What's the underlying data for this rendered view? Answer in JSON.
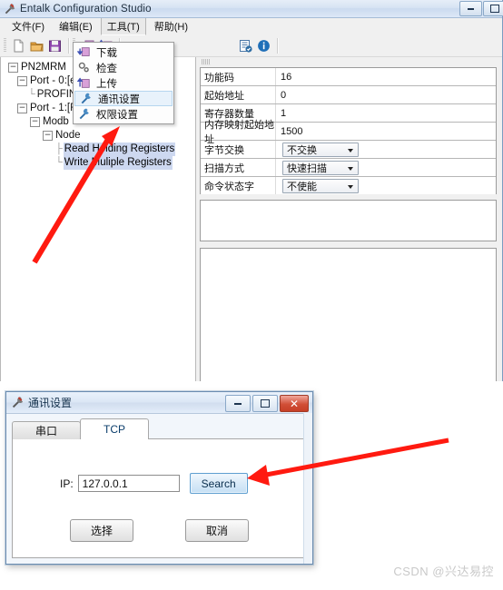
{
  "window": {
    "title": "Entalk Configuration Studio",
    "icon": "app-tools-icon",
    "controls": {
      "minimize": "minimize-icon",
      "maximize": "maximize-icon"
    }
  },
  "menubar": {
    "items": [
      {
        "label": "文件(F)",
        "name": "menu-file",
        "open": false
      },
      {
        "label": "编辑(E)",
        "name": "menu-edit",
        "open": false
      },
      {
        "label": "工具(T)",
        "name": "menu-tools",
        "open": true
      },
      {
        "label": "帮助(H)",
        "name": "menu-help",
        "open": false
      }
    ]
  },
  "toolbar": {
    "items": [
      {
        "icon": "new-file-icon",
        "name": "toolbar-new"
      },
      {
        "icon": "open-folder-icon",
        "name": "toolbar-open"
      },
      {
        "icon": "save-disk-icon",
        "name": "toolbar-save"
      },
      {
        "icon": "download-icon",
        "name": "toolbar-download"
      },
      {
        "icon": "upload-icon",
        "name": "toolbar-upload"
      },
      {
        "icon": "validate-icon",
        "name": "toolbar-validate"
      },
      {
        "icon": "info-icon",
        "name": "toolbar-info"
      }
    ]
  },
  "tools_menu": {
    "items": [
      {
        "label": "下载",
        "icon": "download-icon",
        "highlighted": false
      },
      {
        "label": "检查",
        "icon": "check-gear-icon",
        "highlighted": false
      },
      {
        "label": "上传",
        "icon": "upload-icon",
        "highlighted": false
      },
      {
        "label": "通讯设置",
        "icon": "wrench-icon",
        "highlighted": true
      },
      {
        "label": "权限设置",
        "icon": "wrench-icon",
        "highlighted": false
      }
    ]
  },
  "tree": {
    "nodes": [
      {
        "label": "PN2MRM",
        "indent": 0,
        "expander": "-",
        "selected": false
      },
      {
        "label": "Port - 0:[et",
        "indent": 1,
        "expander": "-",
        "selected": false
      },
      {
        "label": "PROFIN",
        "indent": 2,
        "expander": "",
        "selected": false
      },
      {
        "label": "Port - 1:[RS",
        "indent": 1,
        "expander": "-",
        "selected": false
      },
      {
        "label": "Modb",
        "indent": 2,
        "expander": "-",
        "selected": false
      },
      {
        "label": "Node",
        "indent": 3,
        "expander": "-",
        "selected": false
      },
      {
        "label": "Read Holding Registers",
        "indent": 4,
        "expander": "",
        "selected": true
      },
      {
        "label": "Write Muliple Registers",
        "indent": 4,
        "expander": "",
        "selected": true
      }
    ]
  },
  "properties": {
    "rows": [
      {
        "name": "功能码",
        "value": "16",
        "type": "text"
      },
      {
        "name": "起始地址",
        "value": "0",
        "type": "text"
      },
      {
        "name": "寄存器数量",
        "value": "1",
        "type": "text"
      },
      {
        "name": "内存映射起始地址",
        "value": "1500",
        "type": "text"
      },
      {
        "name": "字节交换",
        "value": "不交换",
        "type": "select"
      },
      {
        "name": "扫描方式",
        "value": "快速扫描",
        "type": "select"
      },
      {
        "name": "命令状态字",
        "value": "不使能",
        "type": "select"
      }
    ]
  },
  "dialog": {
    "title": "通讯设置",
    "icon": "tools-icon",
    "controls": {
      "minimize": "minimize-icon",
      "maximize": "maximize-icon",
      "close": "✕"
    },
    "tabs": [
      {
        "label": "串口",
        "active": false
      },
      {
        "label": "TCP",
        "active": true
      }
    ],
    "ip_label": "IP:",
    "ip_value": "127.0.0.1",
    "ip_placeholder": "127.0.0.1",
    "search_label": "Search",
    "ok_label": "选择",
    "cancel_label": "取消"
  },
  "annotations": {
    "arrow_color": "#ff1a10",
    "arrow_1_target": "write-muliple-registers-tree-node",
    "arrow_2_target": "search-button"
  },
  "watermark": {
    "text": "CSDN @兴达易控"
  }
}
